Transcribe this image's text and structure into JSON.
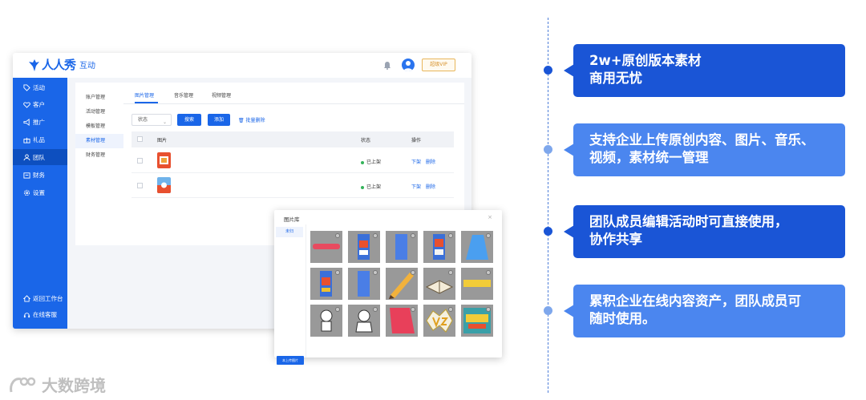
{
  "app": {
    "logo_name": "人人秀",
    "logo_sub": "互动",
    "vip_label": "超级VIP",
    "sidebar": [
      {
        "label": "活动",
        "icon": "tag-icon"
      },
      {
        "label": "客户",
        "icon": "heart-icon"
      },
      {
        "label": "推广",
        "icon": "megaphone-icon"
      },
      {
        "label": "礼品",
        "icon": "gift-icon"
      },
      {
        "label": "团队",
        "icon": "user-icon",
        "active": true
      },
      {
        "label": "财务",
        "icon": "wallet-icon"
      },
      {
        "label": "设置",
        "icon": "gear-icon"
      }
    ],
    "sidebar_bottom": [
      {
        "label": "返回工作台",
        "icon": "home-icon"
      },
      {
        "label": "在线客服",
        "icon": "headset-icon"
      }
    ],
    "submenu": [
      {
        "label": "账户管理"
      },
      {
        "label": "活动管理"
      },
      {
        "label": "模板管理"
      },
      {
        "label": "素材管理",
        "active": true
      },
      {
        "label": "财务管理"
      }
    ],
    "tabs": [
      {
        "label": "图片管理",
        "active": true
      },
      {
        "label": "音乐管理"
      },
      {
        "label": "视频管理"
      }
    ],
    "filter_value": "状态",
    "search_label": "搜索",
    "add_label": "添加",
    "batch_delete_label": "批量删除",
    "table": {
      "headers": [
        "图片",
        "状态",
        "操作"
      ],
      "rows": [
        {
          "status": "已上架",
          "actions": [
            "下架",
            "删除"
          ]
        },
        {
          "status": "已上架",
          "actions": [
            "下架",
            "删除"
          ]
        }
      ]
    }
  },
  "dialog": {
    "title": "图片库",
    "close": "×",
    "side_item": "未归",
    "upload_label": "本上传图片"
  },
  "features": [
    {
      "line1": "2w+原创版本素材",
      "line2": "商用无忧"
    },
    {
      "line1": "支持企业上传原创内容、图片、音乐、",
      "line2": "视频，素材统一管理"
    },
    {
      "line1": "团队成员编辑活动时可直接使用，",
      "line2": "协作共享"
    },
    {
      "line1": "累积企业在线内容资产，团队成员可",
      "line2": "随时使用。"
    }
  ],
  "watermark": "大数跨境",
  "colors": {
    "brand_blue": "#1a66e8",
    "card_dark": "#1a55d6",
    "card_light": "#4b86ef",
    "status_green": "#34b35a"
  }
}
